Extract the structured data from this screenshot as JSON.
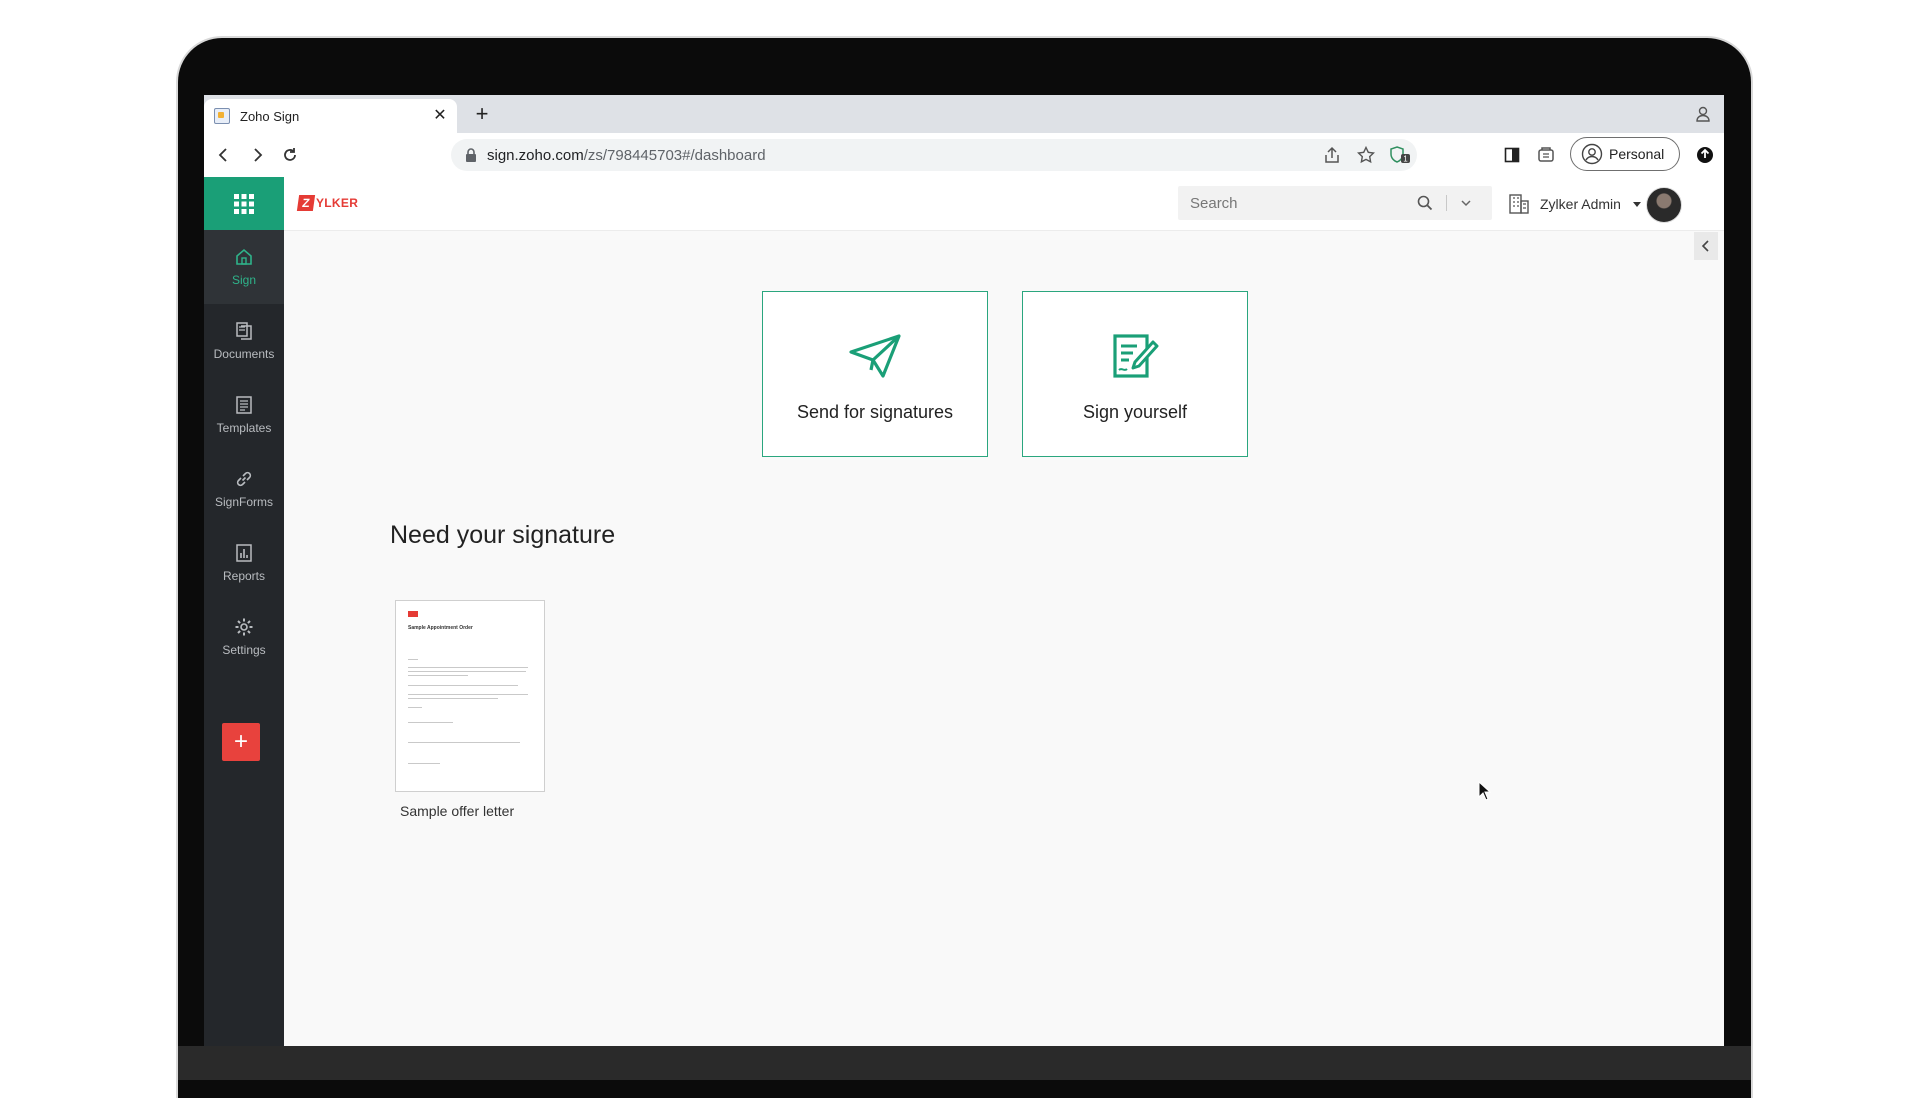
{
  "browser": {
    "tab_title": "Zoho Sign",
    "url_host": "sign.zoho.com",
    "url_path": "/zs/798445703#/dashboard",
    "profile_label": "Personal"
  },
  "app": {
    "logo_text": "YLKER",
    "logo_mark": "Z",
    "search_placeholder": "Search",
    "org_name": "Zylker Admin",
    "accent_color": "#1a9f77",
    "sidebar": {
      "items": [
        {
          "label": "Sign",
          "icon": "home-icon",
          "active": true
        },
        {
          "label": "Documents",
          "icon": "documents-icon"
        },
        {
          "label": "Templates",
          "icon": "templates-icon"
        },
        {
          "label": "SignForms",
          "icon": "link-icon"
        },
        {
          "label": "Reports",
          "icon": "reports-icon"
        },
        {
          "label": "Settings",
          "icon": "gear-icon"
        }
      ],
      "add_label": "+"
    },
    "actions": {
      "send_label": "Send for signatures",
      "sign_label": "Sign yourself"
    },
    "need_signature": {
      "title": "Need your signature",
      "documents": [
        {
          "name": "Sample offer letter",
          "preview_title": "Sample Appointment Order"
        }
      ]
    }
  }
}
